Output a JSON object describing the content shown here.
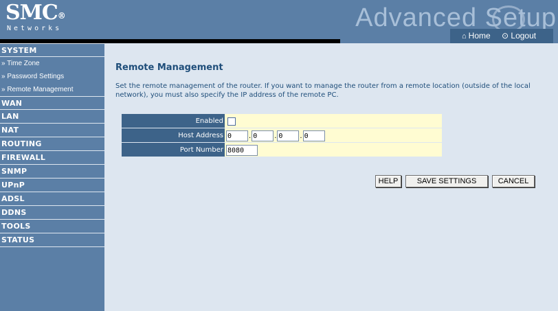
{
  "header": {
    "logo": "SMC",
    "logo_reg": "®",
    "logo_sub": "Networks",
    "advanced_title": "Advanced Setup",
    "home_label": "Home",
    "logout_label": "Logout"
  },
  "sidebar": {
    "sections": [
      {
        "label": "SYSTEM",
        "items": [
          "» Time Zone",
          "» Password Settings",
          "» Remote Management"
        ]
      },
      {
        "label": "WAN"
      },
      {
        "label": "LAN"
      },
      {
        "label": "NAT"
      },
      {
        "label": "ROUTING"
      },
      {
        "label": "FIREWALL"
      },
      {
        "label": "SNMP"
      },
      {
        "label": "UPnP"
      },
      {
        "label": "ADSL"
      },
      {
        "label": "DDNS"
      },
      {
        "label": "TOOLS"
      },
      {
        "label": "STATUS"
      }
    ]
  },
  "main": {
    "title": "Remote Management",
    "description": "Set the remote management of the router. If you want to manage the router from a remote location (outside of the local network), you must also specify the IP address of the remote PC.",
    "form": {
      "enabled_label": "Enabled",
      "enabled_checked": false,
      "host_label": "Host Address",
      "host_octets": [
        "0",
        "0",
        "0",
        "0"
      ],
      "port_label": "Port Number",
      "port_value": "8080"
    },
    "buttons": {
      "help": "HELP",
      "save": "SAVE SETTINGS",
      "cancel": "CANCEL"
    }
  },
  "colors": {
    "sidebar_bg": "#5b7fa6",
    "label_cell_bg": "#3d6389",
    "value_cell_bg": "#fffcd2",
    "main_bg": "#dde6f0",
    "title_text": "#1f4e7a"
  }
}
